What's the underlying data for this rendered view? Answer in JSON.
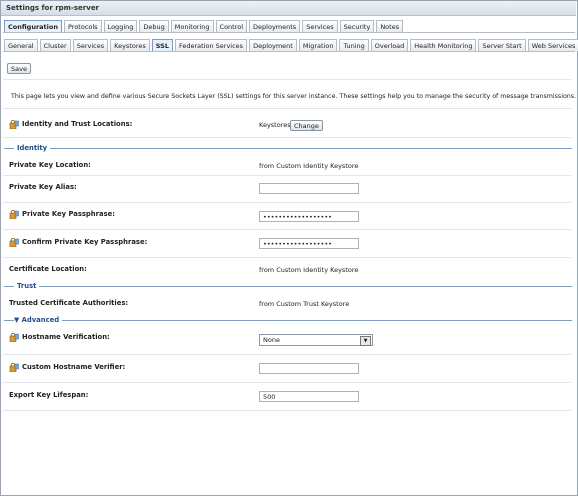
{
  "header": {
    "title": "Settings for rpm-server"
  },
  "main_tabs": [
    "Configuration",
    "Protocols",
    "Logging",
    "Debug",
    "Monitoring",
    "Control",
    "Deployments",
    "Services",
    "Security",
    "Notes"
  ],
  "sub_tabs": [
    "General",
    "Cluster",
    "Services",
    "Keystores",
    "SSL",
    "Federation Services",
    "Deployment",
    "Migration",
    "Tuning",
    "Overload",
    "Health Monitoring",
    "Server Start",
    "Web Services"
  ],
  "toolbar": {
    "save_label": "Save"
  },
  "description": "This page lets you view and define various Secure Sockets Layer (SSL) settings for this server instance. These settings help you to manage the security of message transmissions.",
  "identity_trust": {
    "label": "Identity and Trust Locations:",
    "value": "Keystores",
    "change_label": "Change"
  },
  "sections": {
    "identity": "Identity",
    "trust": "Trust",
    "advanced": "Advanced"
  },
  "identity": {
    "pk_location_label": "Private Key Location:",
    "pk_location_value": "from Custom Identity Keystore",
    "pk_alias_label": "Private Key Alias:",
    "pk_alias_value": "",
    "pk_pass_label": "Private Key Passphrase:",
    "pk_pass_value": "••••••••••••••••••",
    "confirm_pass_label": "Confirm Private Key Passphrase:",
    "confirm_pass_value": "••••••••••••••••••",
    "cert_location_label": "Certificate Location:",
    "cert_location_value": "from Custom Identity Keystore"
  },
  "trust": {
    "tca_label": "Trusted Certificate Authorities:",
    "tca_value": "from Custom Trust Keystore"
  },
  "advanced": {
    "hostname_verif_label": "Hostname Verification:",
    "hostname_verif_value": "None",
    "custom_verifier_label": "Custom Hostname Verifier:",
    "custom_verifier_value": "",
    "export_lifespan_label": "Export Key Lifespan:",
    "export_lifespan_value": "500"
  }
}
